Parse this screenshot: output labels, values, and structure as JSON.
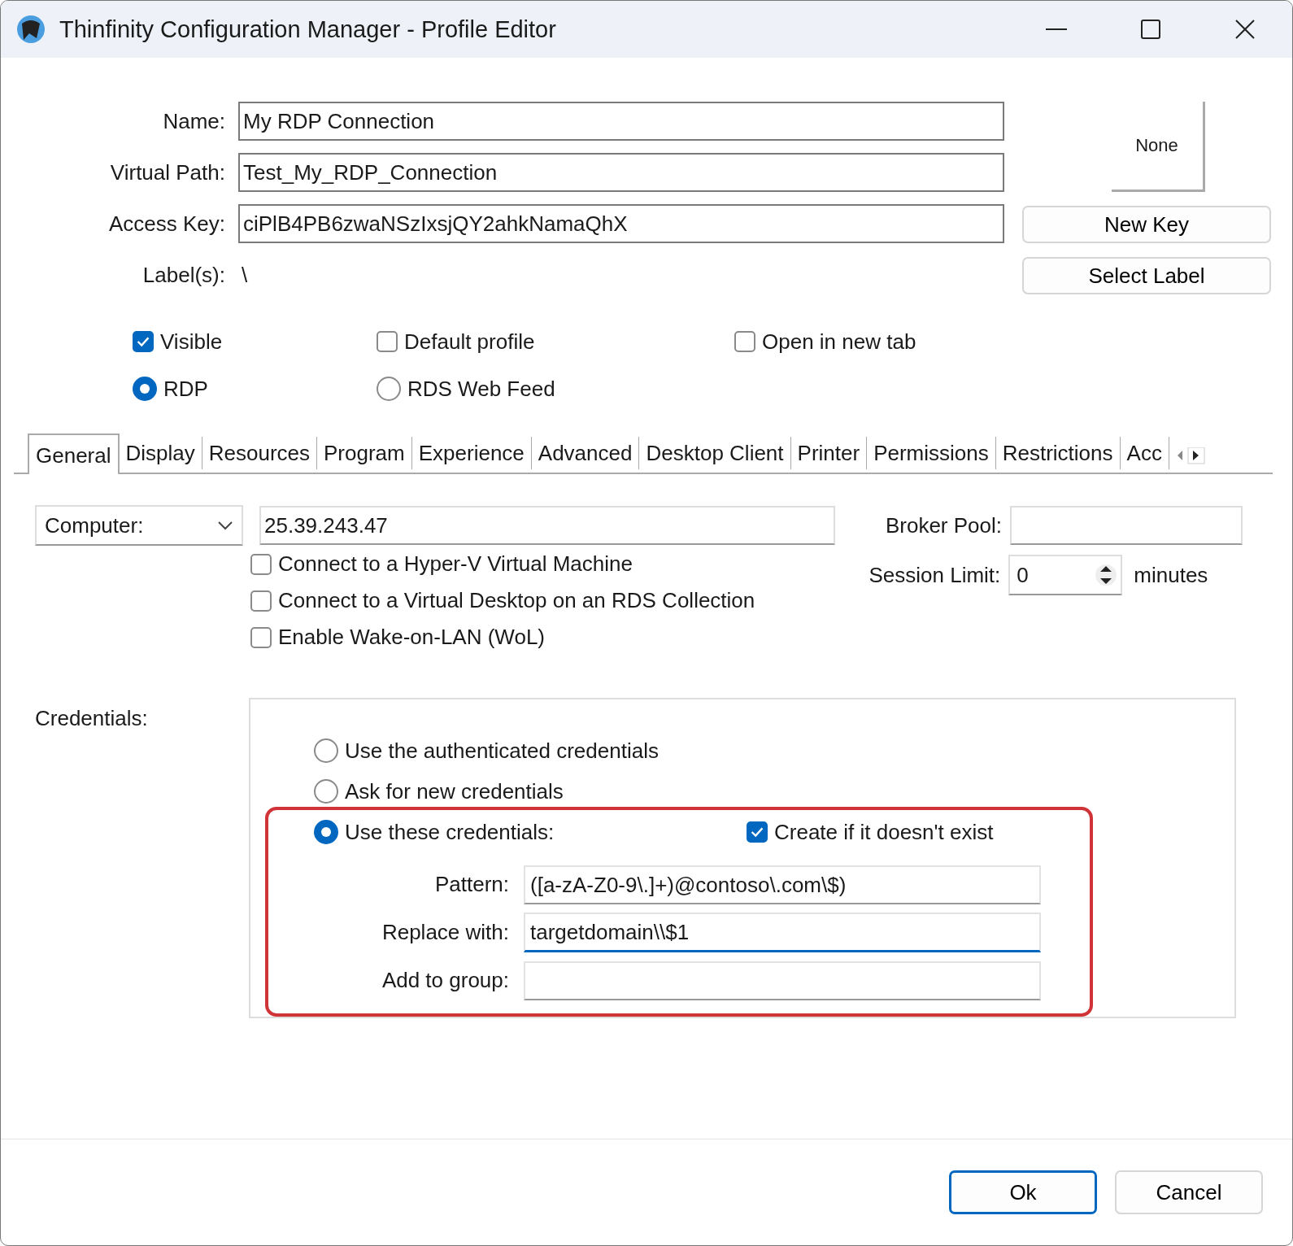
{
  "window": {
    "title": "Thinfinity Configuration Manager - Profile Editor"
  },
  "profile": {
    "fields": [
      {
        "label": "Name:",
        "value": "My RDP Connection"
      },
      {
        "label": "Virtual Path:",
        "value": "Test_My_RDP_Connection"
      },
      {
        "label": "Access Key:",
        "value": "ciPlB4PB6zwaNSzIxsjQY2ahkNamaQhX"
      }
    ],
    "labels": {
      "label": "Label(s):",
      "value": "\\"
    },
    "icon_box": "None",
    "buttons": [
      "New Key",
      "Select Label"
    ]
  },
  "options": [
    {
      "label": "Visible",
      "checked": true
    },
    {
      "label": "Default profile",
      "checked": false
    },
    {
      "label": "Open in new tab",
      "checked": false
    }
  ],
  "profile_type": [
    {
      "label": "RDP",
      "selected": true
    },
    {
      "label": "RDS Web Feed",
      "selected": false
    }
  ],
  "tabs": [
    {
      "label": "General",
      "selected": true
    },
    {
      "label": "Display",
      "selected": false
    },
    {
      "label": "Resources",
      "selected": false
    },
    {
      "label": "Program",
      "selected": false
    },
    {
      "label": "Experience",
      "selected": false
    },
    {
      "label": "Advanced",
      "selected": false
    },
    {
      "label": "Desktop Client",
      "selected": false
    },
    {
      "label": "Printer",
      "selected": false
    },
    {
      "label": "Permissions",
      "selected": false
    },
    {
      "label": "Restrictions",
      "selected": false
    },
    {
      "label": "Acc",
      "selected": false
    }
  ],
  "general": {
    "target_select": {
      "value": "Computer:"
    },
    "address": "25.39.243.47",
    "checkboxes": [
      {
        "label": "Connect to a Hyper-V Virtual Machine",
        "checked": false
      },
      {
        "label": "Connect to a Virtual Desktop on an RDS Collection",
        "checked": false
      },
      {
        "label": "Enable Wake-on-LAN (WoL)",
        "checked": false
      }
    ],
    "broker_pool": {
      "label": "Broker Pool:"
    },
    "session_limit": {
      "label": "Session Limit:",
      "value": "0",
      "unit": "minutes"
    }
  },
  "credentials": {
    "label": "Credentials:",
    "options": [
      {
        "label": "Use the authenticated credentials",
        "selected": false
      },
      {
        "label": "Ask for new credentials",
        "selected": false
      },
      {
        "label": "Use these credentials:",
        "selected": true
      }
    ],
    "create": {
      "label": "Create if it doesn't exist",
      "checked": true
    },
    "fields": [
      {
        "label": "Pattern:",
        "value": "([a-zA-Z0-9\\.]+)@contoso\\.com\\$)",
        "focused": false
      },
      {
        "label": "Replace with:",
        "value": "targetdomain\\\\$1",
        "focused": true
      },
      {
        "label": "Add to group:",
        "focused": false
      }
    ]
  },
  "buttons": [
    {
      "label": "Ok",
      "default": true
    },
    {
      "label": "Cancel",
      "default": false
    }
  ]
}
